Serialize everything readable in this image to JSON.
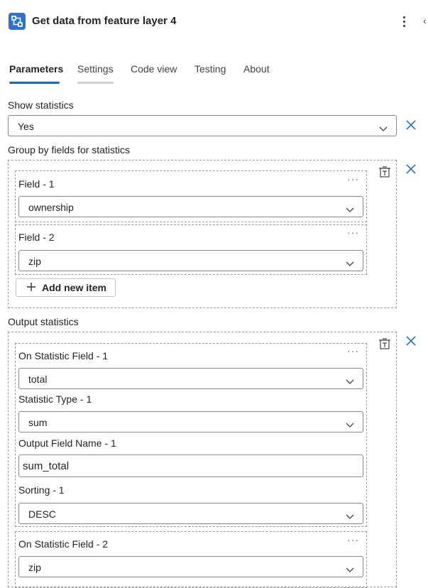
{
  "header": {
    "title": "Get data from feature layer 4",
    "app_icon": "flow-connector-icon",
    "more_icon": "more-vertical-icon",
    "collapse_icon": "chevron-left-icon"
  },
  "tabs": [
    {
      "label": "Parameters",
      "active": true
    },
    {
      "label": "Settings",
      "active": false
    },
    {
      "label": "Code view",
      "active": false
    },
    {
      "label": "Testing",
      "active": false
    },
    {
      "label": "About",
      "active": false
    }
  ],
  "colors": {
    "accent": "#2f6fd6",
    "tab_underline": "#0f6cbd",
    "settings_underline": "#d1d1d1"
  },
  "show_statistics": {
    "label": "Show statistics",
    "value": "Yes"
  },
  "group_by": {
    "label": "Group by fields for statistics",
    "items": [
      {
        "label": "Field - 1",
        "value": "ownership"
      },
      {
        "label": "Field - 2",
        "value": "zip"
      }
    ],
    "add_label": "Add new item"
  },
  "output_statistics": {
    "label": "Output statistics",
    "item1": {
      "field_label": "On Statistic Field - 1",
      "field_value": "total",
      "type_label": "Statistic Type - 1",
      "type_value": "sum",
      "name_label": "Output Field Name - 1",
      "name_value": "sum_total",
      "sort_label": "Sorting - 1",
      "sort_value": "DESC"
    },
    "item2": {
      "field_label": "On Statistic Field - 2",
      "field_value": "zip"
    }
  },
  "ellipsis": "···"
}
